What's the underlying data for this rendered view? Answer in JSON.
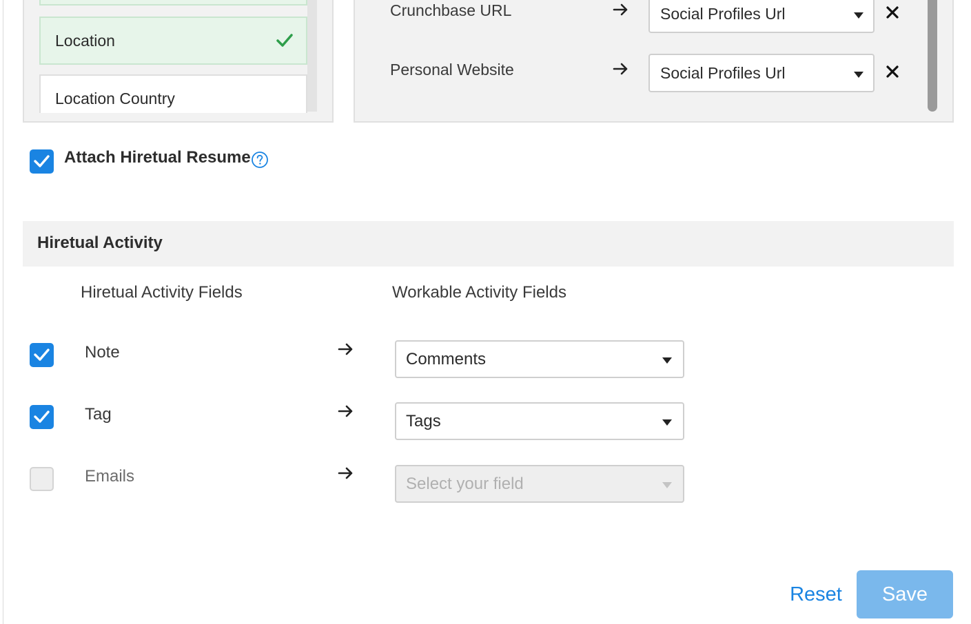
{
  "location_list": {
    "items": [
      {
        "label": "",
        "selected": true
      },
      {
        "label": "Location",
        "selected": true
      },
      {
        "label": "Location Country",
        "selected": false
      }
    ]
  },
  "field_mappings": [
    {
      "source": "Crunchbase URL",
      "target": "Social Profiles Url"
    },
    {
      "source": "Personal Website",
      "target": "Social Profiles Url"
    }
  ],
  "attach_resume": {
    "label": "Attach Hiretual Resume",
    "checked": true
  },
  "activity": {
    "title": "Hiretual Activity",
    "col_source": "Hiretual Activity Fields",
    "col_target": "Workable Activity Fields",
    "rows": [
      {
        "label": "Note",
        "checked": true,
        "value": "Comments"
      },
      {
        "label": "Tag",
        "checked": true,
        "value": "Tags"
      },
      {
        "label": "Emails",
        "checked": false,
        "value": "",
        "placeholder": "Select your field"
      }
    ]
  },
  "footer": {
    "reset_label": "Reset",
    "save_label": "Save"
  },
  "colors": {
    "accent": "#1a84e2",
    "save_button": "#7ab8ec",
    "selected_item": "#e7f5ea",
    "check": "#2e9e4a"
  }
}
